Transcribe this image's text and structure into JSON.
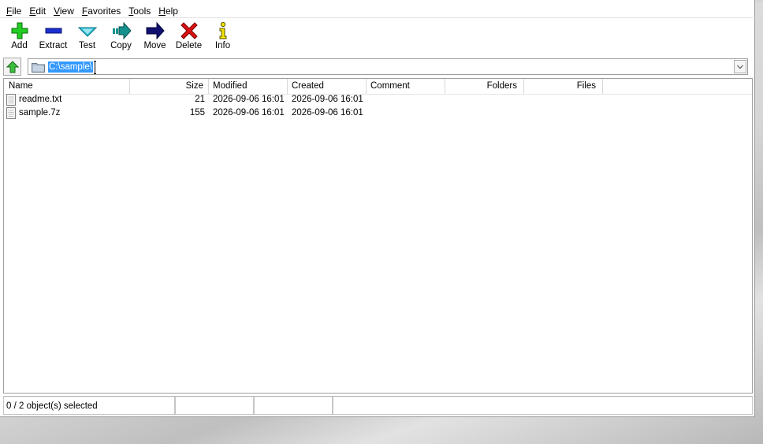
{
  "menu": [
    {
      "label": "File",
      "key": "F",
      "rest": "ile"
    },
    {
      "label": "Edit",
      "key": "E",
      "rest": "dit"
    },
    {
      "label": "View",
      "key": "V",
      "rest": "iew"
    },
    {
      "label": "Favorites",
      "key": "F",
      "rest": "avorites"
    },
    {
      "label": "Tools",
      "key": "T",
      "rest": "ools"
    },
    {
      "label": "Help",
      "key": "H",
      "rest": "elp"
    }
  ],
  "toolbar": {
    "add": "Add",
    "extract": "Extract",
    "test": "Test",
    "copy": "Copy",
    "move": "Move",
    "delete": "Delete",
    "info": "Info"
  },
  "address": {
    "path": "C:\\sample\\"
  },
  "columns": {
    "name": "Name",
    "size": "Size",
    "modified": "Modified",
    "created": "Created",
    "comment": "Comment",
    "folders": "Folders",
    "files": "Files"
  },
  "files": [
    {
      "name": "readme.txt",
      "size": "21",
      "modified": "2026-09-06 16:01",
      "created": "2026-09-06 16:01"
    },
    {
      "name": "sample.7z",
      "size": "155",
      "modified": "2026-09-06 16:01",
      "created": "2026-09-06 16:01"
    }
  ],
  "status": {
    "selection": "0 / 2 object(s) selected"
  },
  "colors": {
    "selection_highlight": "#3399ff",
    "add_green": "#22cc22",
    "extract_blue": "#1c2fd0",
    "test_cyan": "#22c4dd",
    "copy_teal": "#14918c",
    "move_navy": "#101070",
    "delete_red": "#dd1111",
    "info_yellow": "#f2e400"
  }
}
